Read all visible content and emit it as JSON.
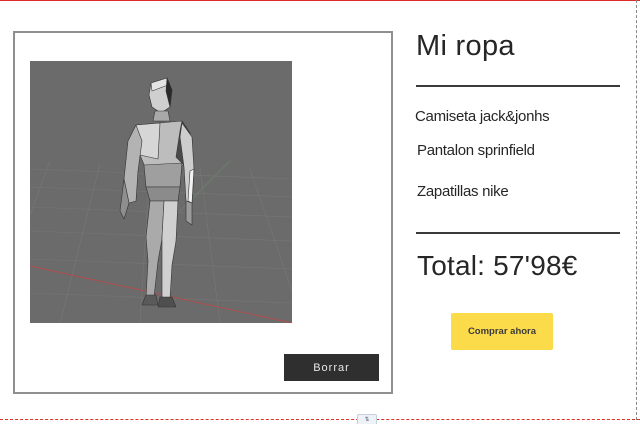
{
  "viewer": {
    "model_alt": "low-poly human 3D model",
    "delete_label": "Borrar"
  },
  "cart": {
    "title": "Mi ropa",
    "items": [
      "Camiseta jack&jonhs",
      "Pantalon sprinfield",
      "Zapatillas nike"
    ],
    "total_label": "Total: 57'98€",
    "buy_label": "Comprar ahora"
  },
  "editor": {
    "section_handle_icon": "section-handle-icon"
  },
  "colors": {
    "buy_button": "#fbdb4a",
    "delete_button": "#2f2f2f",
    "viewport_bg": "#6b6b6b",
    "guide_red": "#e02b2b"
  }
}
